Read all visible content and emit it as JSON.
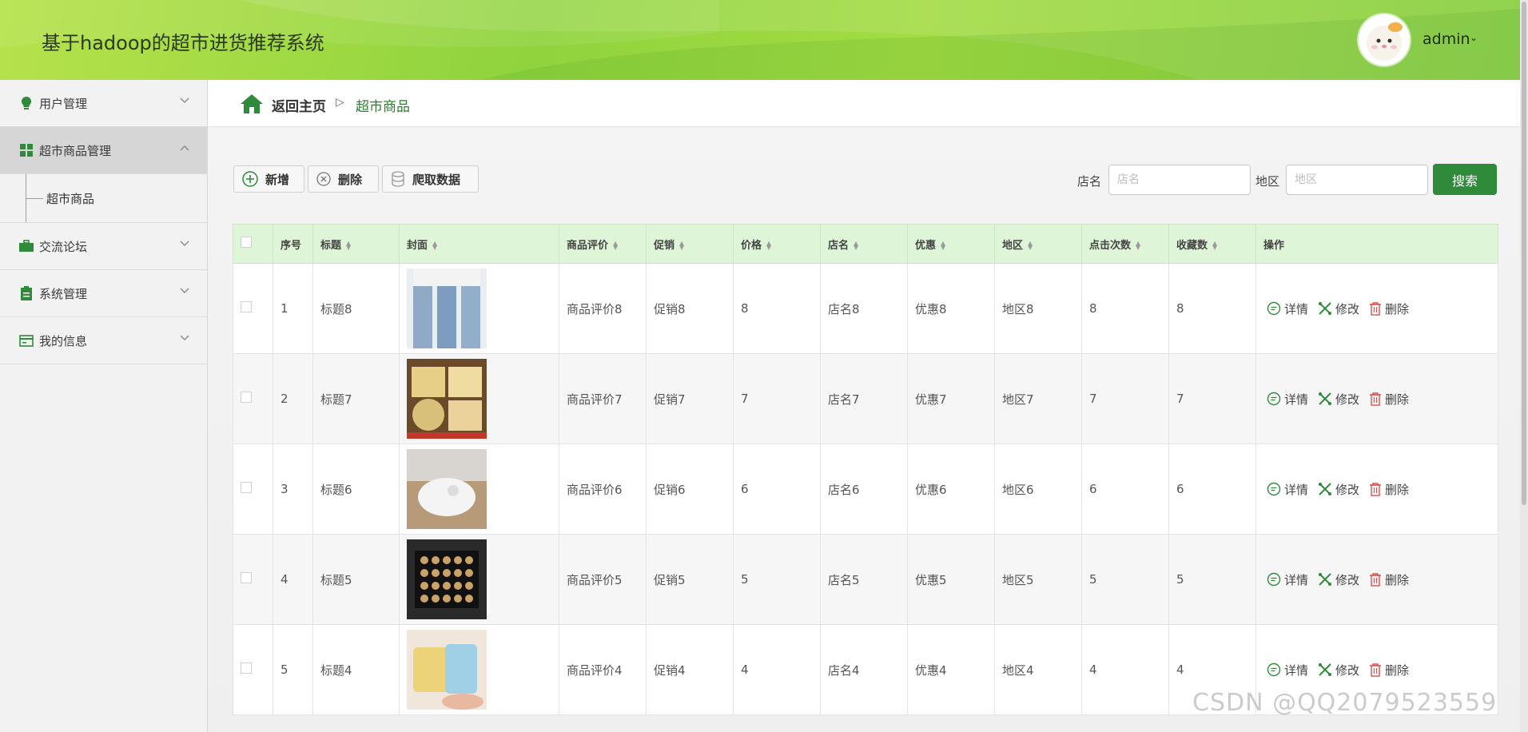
{
  "header": {
    "app_title": "基于hadoop的超市进货推荐系统",
    "user_name": "admin",
    "accent_color": "#8fd33d"
  },
  "sidebar": {
    "items": [
      {
        "label": "用户管理",
        "icon": "bulb-icon"
      },
      {
        "label": "超市商品管理",
        "icon": "grid-icon",
        "expanded": true
      },
      {
        "label": "交流论坛",
        "icon": "briefcase-icon"
      },
      {
        "label": "系统管理",
        "icon": "clipboard-icon"
      },
      {
        "label": "我的信息",
        "icon": "card-icon"
      }
    ],
    "sub_items": [
      {
        "label": "超市商品"
      }
    ]
  },
  "breadcrumb": {
    "home": "返回主页",
    "separator": "▷",
    "current": "超市商品"
  },
  "toolbar": {
    "add_label": "新增",
    "delete_label": "删除",
    "crawl_label": "爬取数据"
  },
  "search": {
    "shop_label": "店名",
    "shop_placeholder": "店名",
    "region_label": "地区",
    "region_placeholder": "地区",
    "button_label": "搜索"
  },
  "table": {
    "columns": [
      "序号",
      "标题",
      "封面",
      "商品评价",
      "促销",
      "价格",
      "店名",
      "优惠",
      "地区",
      "点击次数",
      "收藏数",
      "操作"
    ],
    "action_labels": {
      "detail": "详情",
      "edit": "修改",
      "delete": "删除"
    },
    "rows": [
      {
        "index": "1",
        "title": "标题8",
        "cover": "jeans-photo",
        "review": "商品评价8",
        "promo": "促销8",
        "price": "8",
        "shop": "店名8",
        "discount": "优惠8",
        "region": "地区8",
        "clicks": "8",
        "favorites": "8"
      },
      {
        "index": "2",
        "title": "标题7",
        "cover": "pastry-box-photo",
        "review": "商品评价7",
        "promo": "促销7",
        "price": "7",
        "shop": "店名7",
        "discount": "优惠7",
        "region": "地区7",
        "clicks": "7",
        "favorites": "7"
      },
      {
        "index": "3",
        "title": "标题6",
        "cover": "robot-vacuum-photo",
        "review": "商品评价6",
        "promo": "促销6",
        "price": "6",
        "shop": "店名6",
        "discount": "优惠6",
        "region": "地区6",
        "clicks": "6",
        "favorites": "6"
      },
      {
        "index": "4",
        "title": "标题5",
        "cover": "chocolate-box-photo",
        "review": "商品评价5",
        "promo": "促销5",
        "price": "5",
        "shop": "店名5",
        "discount": "优惠5",
        "region": "地区5",
        "clicks": "5",
        "favorites": "5"
      },
      {
        "index": "5",
        "title": "标题4",
        "cover": "cookie-tin-photo",
        "review": "商品评价4",
        "promo": "促销4",
        "price": "4",
        "shop": "店名4",
        "discount": "优惠4",
        "region": "地区4",
        "clicks": "4",
        "favorites": "4"
      }
    ]
  },
  "watermark": "CSDN @QQ2079523559"
}
